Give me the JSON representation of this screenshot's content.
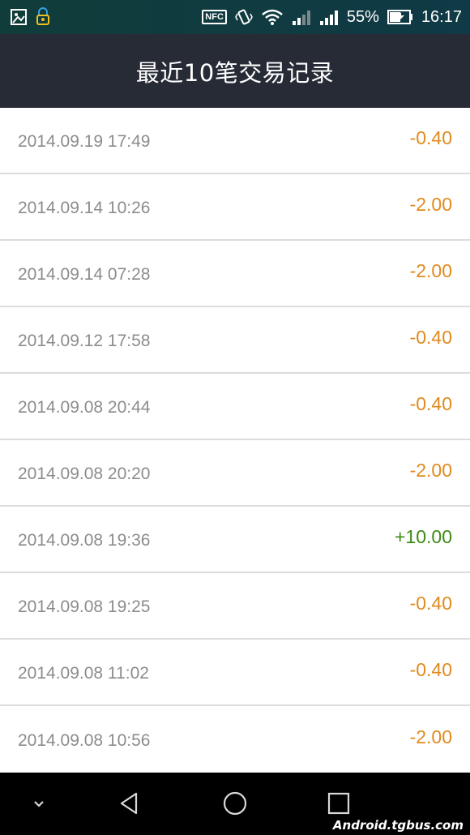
{
  "status_bar": {
    "battery_percent": "55%",
    "time": "16:17",
    "nfc_label": "NFC",
    "left_icons": [
      "image-icon",
      "lock-notification-icon"
    ],
    "right_icons": [
      "nfc-icon",
      "vibrate-icon",
      "wifi-icon",
      "signal-icon",
      "signal-icon-2",
      "battery-icon"
    ]
  },
  "header": {
    "title": "最近10笔交易记录"
  },
  "transactions": [
    {
      "datetime": "2014.09.19 17:49",
      "amount": "-0.40",
      "type": "debit"
    },
    {
      "datetime": "2014.09.14 10:26",
      "amount": "-2.00",
      "type": "debit"
    },
    {
      "datetime": "2014.09.14 07:28",
      "amount": "-2.00",
      "type": "debit"
    },
    {
      "datetime": "2014.09.12 17:58",
      "amount": "-0.40",
      "type": "debit"
    },
    {
      "datetime": "2014.09.08 20:44",
      "amount": "-0.40",
      "type": "debit"
    },
    {
      "datetime": "2014.09.08 20:20",
      "amount": "-2.00",
      "type": "debit"
    },
    {
      "datetime": "2014.09.08 19:36",
      "amount": "+10.00",
      "type": "credit"
    },
    {
      "datetime": "2014.09.08 19:25",
      "amount": "-0.40",
      "type": "debit"
    },
    {
      "datetime": "2014.09.08 11:02",
      "amount": "-0.40",
      "type": "debit"
    },
    {
      "datetime": "2014.09.08 10:56",
      "amount": "-2.00",
      "type": "debit"
    }
  ],
  "nav_bar": {
    "buttons": [
      "chevron-down-icon",
      "back-icon",
      "home-icon",
      "recents-icon"
    ],
    "watermark": "Android.tgbus.com"
  },
  "colors": {
    "header_bg": "#272b36",
    "debit": "#e08a1e",
    "credit": "#3d8a14",
    "date_text": "#8c8c8c",
    "divider": "#dcdcdc"
  }
}
